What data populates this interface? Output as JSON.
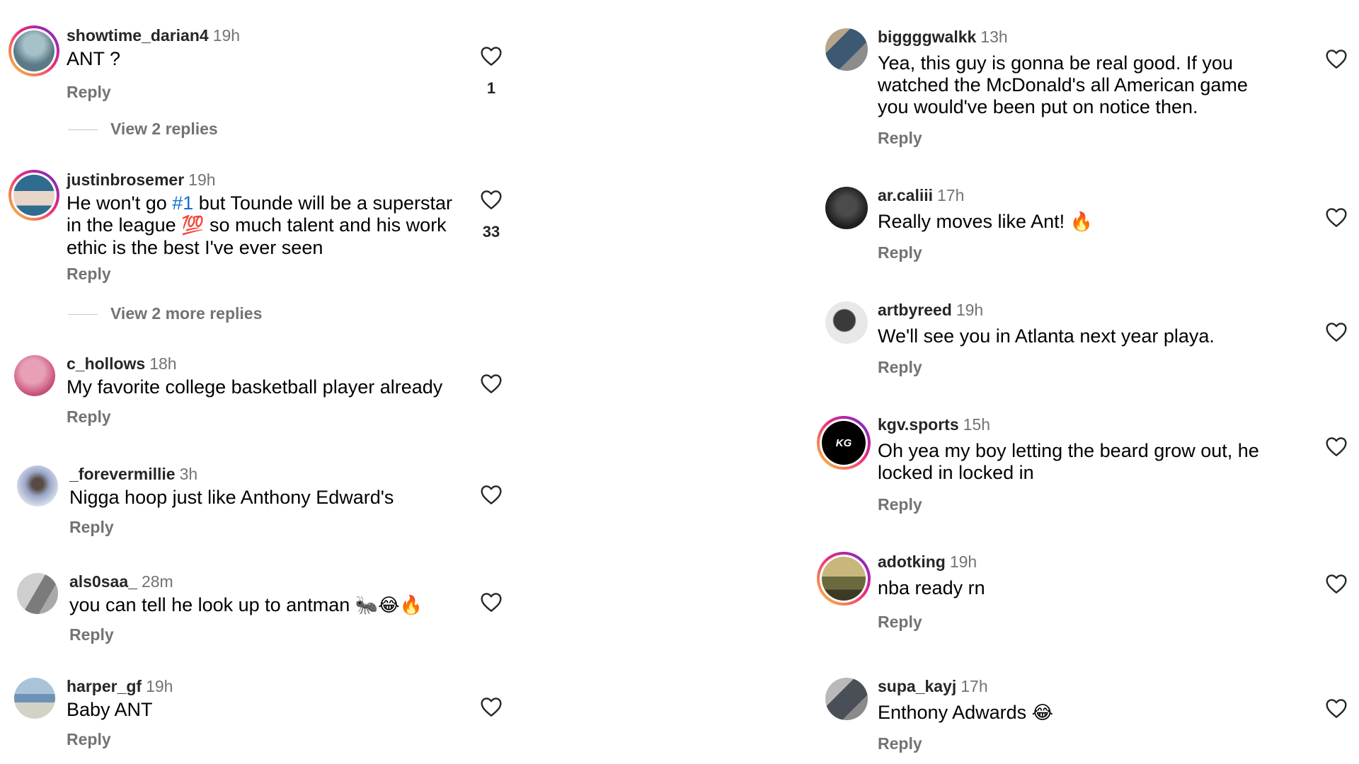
{
  "left_column": [
    {
      "username": "showtime_darian4",
      "time": "19h",
      "text": "ANT ?",
      "reply_label": "Reply",
      "likes": "1",
      "view_replies": "View 2 replies",
      "avatar": {
        "story_ring": true,
        "colors": [
          "#5a7a86",
          "#a7c1c9"
        ]
      }
    },
    {
      "username": "justinbrosemer",
      "time": "19h",
      "text_parts": [
        "He won't go ",
        "#1",
        " but Tounde will be a superstar in the league ",
        "💯",
        " so much talent and his work ethic is the best I've ever seen"
      ],
      "reply_label": "Reply",
      "likes": "33",
      "view_replies": "View 2 more replies",
      "avatar": {
        "story_ring": true,
        "colors": [
          "#2f6c8f",
          "#e8d6c8"
        ]
      }
    },
    {
      "username": "c_hollows",
      "time": "18h",
      "text": "My favorite college basketball player already",
      "reply_label": "Reply",
      "avatar": {
        "story_ring": false,
        "colors": [
          "#c64f79",
          "#e7a0b5"
        ]
      }
    },
    {
      "username": "_forevermillie",
      "time": "3h",
      "text": "Nigga hoop just like Anthony Edward's",
      "reply_label": "Reply",
      "avatar": {
        "story_ring": false,
        "colors": [
          "#9aa7c8",
          "#dde2ee"
        ]
      }
    },
    {
      "username": "als0saa_",
      "time": "28m",
      "text": "you can tell he look up to antman",
      "emojis": "🐜😂🔥",
      "reply_label": "Reply",
      "avatar": {
        "story_ring": false,
        "colors": [
          "#7b7b7b",
          "#cfcfcf"
        ]
      }
    },
    {
      "username": "harper_gf",
      "time": "19h",
      "text": "Baby ANT",
      "reply_label": "Reply",
      "avatar": {
        "story_ring": false,
        "colors": [
          "#6c93b5",
          "#d4d1c7"
        ]
      }
    }
  ],
  "right_column": [
    {
      "username": "biggggwalkk",
      "time": "13h",
      "text": "Yea, this guy is gonna be real good. If you watched the McDonald's all American game you would've been put on notice then.",
      "reply_label": "Reply",
      "avatar": {
        "story_ring": false,
        "colors": [
          "#3d5873",
          "#b7a58a"
        ]
      }
    },
    {
      "username": "ar.caliii",
      "time": "17h",
      "text": "Really moves like Ant!",
      "emojis": "🔥",
      "reply_label": "Reply",
      "avatar": {
        "story_ring": false,
        "colors": [
          "#1f1f1f",
          "#4b4b4b"
        ]
      }
    },
    {
      "username": "artbyreed",
      "time": "19h",
      "text": "We'll see you in Atlanta next year playa.",
      "reply_label": "Reply",
      "avatar": {
        "story_ring": false,
        "colors": [
          "#3a3a3a",
          "#e8e8e8"
        ]
      }
    },
    {
      "username": "kgv.sports",
      "time": "15h",
      "text": "Oh yea my boy letting the beard grow out, he locked in locked in",
      "reply_label": "Reply",
      "logo_text": "KG",
      "avatar": {
        "story_ring": true,
        "colors": [
          "#000000",
          "#000000"
        ]
      }
    },
    {
      "username": "adotking",
      "time": "19h",
      "text": "nba ready rn",
      "reply_label": "Reply",
      "avatar": {
        "story_ring": true,
        "colors": [
          "#6b6a3f",
          "#c8b77d"
        ]
      }
    },
    {
      "username": "supa_kayj",
      "time": "17h",
      "text": "Enthony Adwards",
      "emojis": "😂",
      "reply_label": "Reply",
      "avatar": {
        "story_ring": false,
        "colors": [
          "#4a4f57",
          "#b9b9b9"
        ]
      }
    }
  ],
  "colors": {
    "link_blue": "#0f6fd6",
    "muted": "#737373",
    "username": "#262626"
  }
}
